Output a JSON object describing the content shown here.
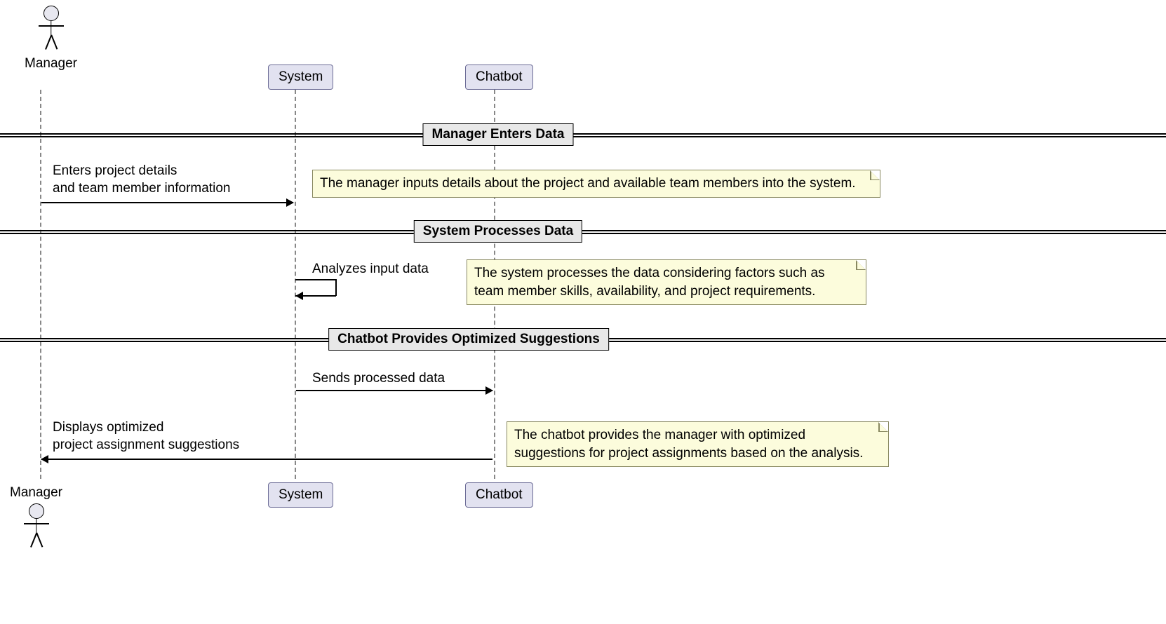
{
  "actors": {
    "manager": {
      "label_top": "Manager",
      "label_bottom": "Manager"
    }
  },
  "participants": {
    "system": {
      "label_top": "System",
      "label_bottom": "System"
    },
    "chatbot": {
      "label_top": "Chatbot",
      "label_bottom": "Chatbot"
    }
  },
  "sections": {
    "s1": {
      "title": "Manager Enters Data"
    },
    "s2": {
      "title": "System Processes Data"
    },
    "s3": {
      "title": "Chatbot Provides Optimized Suggestions"
    }
  },
  "messages": {
    "m1": {
      "line1": "Enters project details",
      "line2": "and team member information"
    },
    "m2": {
      "line1": "Analyzes input data"
    },
    "m3": {
      "line1": "Sends processed data"
    },
    "m4": {
      "line1": "Displays optimized",
      "line2": "project assignment suggestions"
    }
  },
  "notes": {
    "n1": "The manager inputs details about the project and available team members into the system.",
    "n2_line1": "The system processes the data considering factors such as",
    "n2_line2": "team member skills, availability, and project requirements.",
    "n3_line1": "The chatbot provides the manager with optimized",
    "n3_line2": "suggestions for project assignments based on the analysis."
  }
}
